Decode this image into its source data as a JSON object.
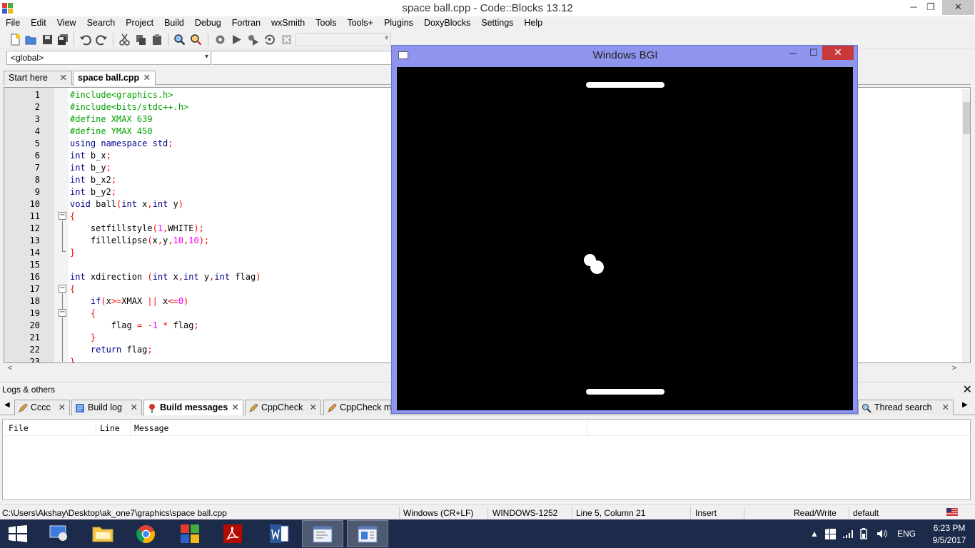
{
  "window": {
    "title": "space ball.cpp - Code::Blocks 13.12",
    "min": "─",
    "max": "❐",
    "close": "✕"
  },
  "menu": [
    "File",
    "Edit",
    "View",
    "Search",
    "Project",
    "Build",
    "Debug",
    "Fortran",
    "wxSmith",
    "Tools",
    "Tools+",
    "Plugins",
    "DoxyBlocks",
    "Settings",
    "Help"
  ],
  "toolbar": {
    "icons": [
      "new-file-icon",
      "open-folder-icon",
      "save-icon",
      "save-all-icon",
      "undo-icon",
      "redo-icon",
      "cut-icon",
      "copy-icon",
      "paste-icon",
      "find-icon",
      "replace-icon",
      "build-icon",
      "run-icon",
      "build-run-icon",
      "rebuild-icon",
      "abort-icon"
    ]
  },
  "scope": {
    "value": "<global>",
    "arrow": "▾"
  },
  "editor_tabs": [
    {
      "label": "Start here",
      "close": "✕"
    },
    {
      "label": "space ball.cpp",
      "close": "✕",
      "active": true
    }
  ],
  "code": {
    "lines": [
      {
        "n": "1",
        "parts": [
          [
            "pp",
            "#include<graphics.h>"
          ]
        ]
      },
      {
        "n": "2",
        "parts": [
          [
            "pp",
            "#include<bits/stdc++.h>"
          ]
        ]
      },
      {
        "n": "3",
        "parts": [
          [
            "pp",
            "#define XMAX 639"
          ]
        ]
      },
      {
        "n": "4",
        "parts": [
          [
            "pp",
            "#define YMAX 450"
          ]
        ]
      },
      {
        "n": "5",
        "parts": [
          [
            "kw",
            "using namespace "
          ],
          [
            "kw",
            "std"
          ],
          [
            "op",
            ";"
          ]
        ]
      },
      {
        "n": "6",
        "parts": [
          [
            "kw",
            "int "
          ],
          [
            "tx",
            "b_x"
          ],
          [
            "op",
            ";"
          ]
        ]
      },
      {
        "n": "7",
        "parts": [
          [
            "kw",
            "int "
          ],
          [
            "tx",
            "b_y"
          ],
          [
            "op",
            ";"
          ]
        ]
      },
      {
        "n": "8",
        "parts": [
          [
            "kw",
            "int "
          ],
          [
            "tx",
            "b_x2"
          ],
          [
            "op",
            ";"
          ]
        ]
      },
      {
        "n": "9",
        "parts": [
          [
            "kw",
            "int "
          ],
          [
            "tx",
            "b_y2"
          ],
          [
            "op",
            ";"
          ]
        ]
      },
      {
        "n": "10",
        "parts": [
          [
            "kw",
            "void "
          ],
          [
            "tx",
            "ball"
          ],
          [
            "op",
            "("
          ],
          [
            "kw",
            "int "
          ],
          [
            "tx",
            "x"
          ],
          [
            "op",
            ","
          ],
          [
            "kw",
            "int "
          ],
          [
            "tx",
            "y"
          ],
          [
            "op",
            ")"
          ]
        ]
      },
      {
        "n": "11",
        "parts": [
          [
            "op",
            "{"
          ]
        ]
      },
      {
        "n": "12",
        "parts": [
          [
            "tx",
            "    setfillstyle"
          ],
          [
            "op",
            "("
          ],
          [
            "num",
            "1"
          ],
          [
            "op",
            ","
          ],
          [
            "tx",
            "WHITE"
          ],
          [
            "op",
            ");"
          ]
        ]
      },
      {
        "n": "13",
        "parts": [
          [
            "tx",
            "    fillellipse"
          ],
          [
            "op",
            "("
          ],
          [
            "tx",
            "x"
          ],
          [
            "op",
            ","
          ],
          [
            "tx",
            "y"
          ],
          [
            "op",
            ","
          ],
          [
            "num",
            "10"
          ],
          [
            "op",
            ","
          ],
          [
            "num",
            "10"
          ],
          [
            "op",
            ");"
          ]
        ]
      },
      {
        "n": "14",
        "parts": [
          [
            "op",
            "}"
          ]
        ]
      },
      {
        "n": "15",
        "parts": [
          [
            "tx",
            ""
          ]
        ]
      },
      {
        "n": "16",
        "parts": [
          [
            "kw",
            "int "
          ],
          [
            "tx",
            "xdirection "
          ],
          [
            "op",
            "("
          ],
          [
            "kw",
            "int "
          ],
          [
            "tx",
            "x"
          ],
          [
            "op",
            ","
          ],
          [
            "kw",
            "int "
          ],
          [
            "tx",
            "y"
          ],
          [
            "op",
            ","
          ],
          [
            "kw",
            "int "
          ],
          [
            "tx",
            "flag"
          ],
          [
            "op",
            ")"
          ]
        ]
      },
      {
        "n": "17",
        "parts": [
          [
            "op",
            "{"
          ]
        ]
      },
      {
        "n": "18",
        "parts": [
          [
            "kw",
            "    if"
          ],
          [
            "op",
            "("
          ],
          [
            "tx",
            "x"
          ],
          [
            "op",
            ">="
          ],
          [
            "tx",
            "XMAX "
          ],
          [
            "op",
            "|| "
          ],
          [
            "tx",
            "x"
          ],
          [
            "op",
            "<="
          ],
          [
            "num",
            "0"
          ],
          [
            "op",
            ")"
          ]
        ]
      },
      {
        "n": "19",
        "parts": [
          [
            "op",
            "    {"
          ]
        ]
      },
      {
        "n": "20",
        "parts": [
          [
            "tx",
            "        flag "
          ],
          [
            "op",
            "= -"
          ],
          [
            "num",
            "1 "
          ],
          [
            "op",
            "* "
          ],
          [
            "tx",
            "flag"
          ],
          [
            "op",
            ";"
          ]
        ]
      },
      {
        "n": "21",
        "parts": [
          [
            "op",
            "    }"
          ]
        ]
      },
      {
        "n": "22",
        "parts": [
          [
            "kw",
            "    return "
          ],
          [
            "tx",
            "flag"
          ],
          [
            "op",
            ";"
          ]
        ]
      },
      {
        "n": "23",
        "parts": [
          [
            "op",
            "}"
          ]
        ]
      }
    ]
  },
  "logs": {
    "title": "Logs & others",
    "close": "✕",
    "tabs": [
      {
        "label": "Cccc",
        "close": "✕"
      },
      {
        "label": "Build log",
        "close": "✕"
      },
      {
        "label": "Build messages",
        "close": "✕",
        "active": true
      },
      {
        "label": "CppCheck",
        "close": "✕"
      },
      {
        "label": "CppCheck mes"
      },
      {
        "label": "Thread search",
        "close": "✕"
      }
    ],
    "columns": [
      "File",
      "Line",
      "Message"
    ]
  },
  "status": {
    "path": "C:\\Users\\Akshay\\Desktop\\ak_one7\\graphics\\space ball.cpp",
    "eol": "Windows (CR+LF)",
    "encoding": "WINDOWS-1252",
    "position": "Line 5, Column 21",
    "mode": "Insert",
    "access": "Read/Write",
    "lang": "default"
  },
  "bgi": {
    "title": "Windows BGI",
    "min": "─",
    "max": "☐",
    "close": "✕"
  },
  "taskbar": {
    "apps": [
      "start-button",
      "control-panel-icon",
      "file-explorer-icon",
      "chrome-icon",
      "codeblocks-icon",
      "acrobat-icon",
      "word-icon",
      "bgi-window-icon",
      "codeblocks-window-icon"
    ],
    "lang": "ENG",
    "time": "6:23 PM",
    "date": "9/5/2017"
  }
}
